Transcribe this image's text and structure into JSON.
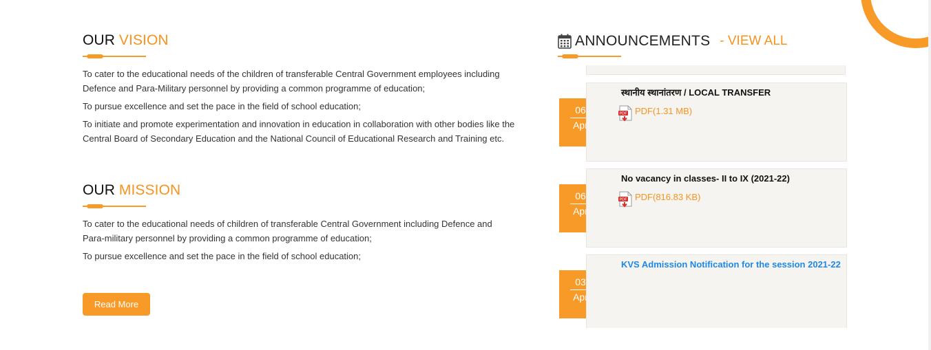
{
  "vision": {
    "heading_dark": "OUR",
    "heading_accent": "VISION",
    "paragraphs": [
      "To cater to the educational needs of the children of transferable Central Government employees including Defence and Para-Military personnel by providing a common programme of education;",
      "To pursue excellence and set the pace in the field of school education;",
      "To initiate and promote experimentation and innovation in education in collaboration with other bodies like the Central Board of Secondary Education and the National Council of Educational Research and Training etc."
    ]
  },
  "mission": {
    "heading_dark": "OUR",
    "heading_accent": "MISSION",
    "paragraphs": [
      "To cater to the educational needs of children of transferable Central Government including Defence and Para-military personnel by providing a common programme of education;",
      "To pursue excellence and set the pace in the field of school education;"
    ]
  },
  "read_more_label": "Read More",
  "announcements": {
    "title": "ANNOUNCEMENTS",
    "view_all": "- VIEW ALL",
    "items": [
      {
        "day": "06",
        "month": "Apr",
        "title": "स्थानीय स्थानांतरण / LOCAL TRANSFER",
        "pdf_label": "PDF(1.31 MB)",
        "is_link": false
      },
      {
        "day": "06",
        "month": "Apr",
        "title": "No vacancy in classes- II to IX (2021-22)",
        "pdf_label": "PDF(816.83 KB)",
        "is_link": false
      },
      {
        "day": "03",
        "month": "Apr",
        "title": "KVS Admission Notification for the session 2021-22",
        "pdf_label": "",
        "is_link": true
      }
    ]
  },
  "colors": {
    "accent": "#f79a27",
    "link": "#1e88e5",
    "card_bg": "#f5f4f1"
  },
  "icons": {
    "calendar": "calendar-icon",
    "pdf": "pdf-file-icon"
  }
}
